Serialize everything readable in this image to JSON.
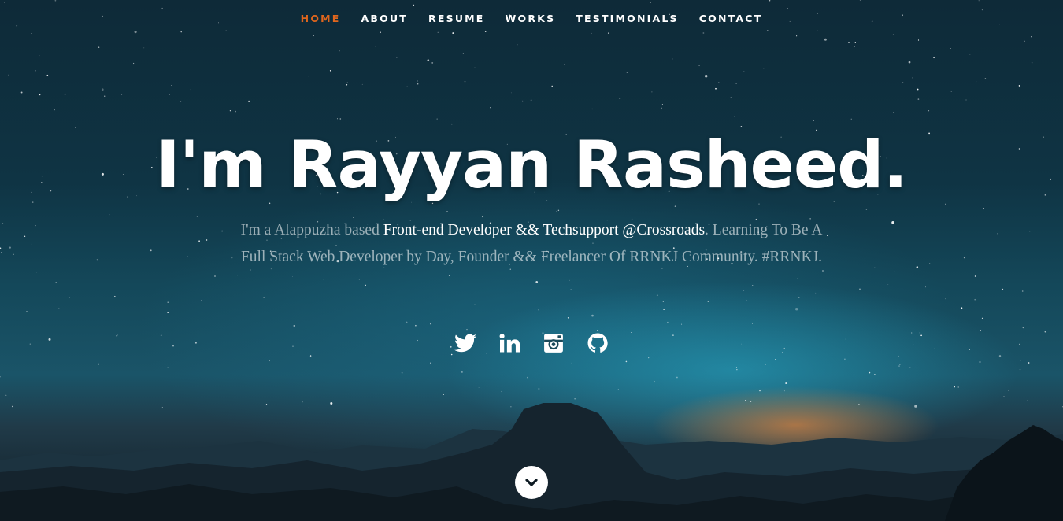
{
  "nav": {
    "items": [
      {
        "label": "HOME",
        "active": true
      },
      {
        "label": "ABOUT",
        "active": false
      },
      {
        "label": "RESUME",
        "active": false
      },
      {
        "label": "WORKS",
        "active": false
      },
      {
        "label": "TESTIMONIALS",
        "active": false
      },
      {
        "label": "CONTACT",
        "active": false
      }
    ],
    "active_color": "#e0661d"
  },
  "hero": {
    "title": "I'm Rayyan Rasheed.",
    "intro_prefix": "I'm a Alappuzha based ",
    "intro_highlight": "Front-end Developer && Techsupport @Crossroads",
    "intro_suffix": ". Learning To Be A Full Stack Web Developer by Day, Founder && Freelancer Of RRNKJ Community. #RRNKJ."
  },
  "social": [
    {
      "icon": "twitter-icon"
    },
    {
      "icon": "linkedin-icon"
    },
    {
      "icon": "instagram-icon"
    },
    {
      "icon": "github-icon"
    }
  ],
  "scroll_down": {
    "icon": "chevron-down-icon"
  }
}
